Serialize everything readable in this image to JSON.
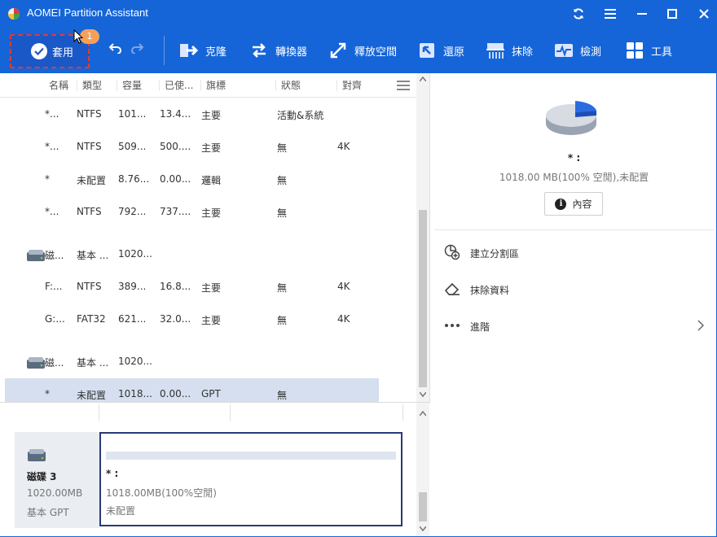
{
  "app": {
    "title": "AOMEI Partition Assistant"
  },
  "toolbar": {
    "apply_label": "套用",
    "pending_count": "1",
    "items": [
      {
        "label": "克隆",
        "icon": "clone-icon"
      },
      {
        "label": "轉換器",
        "icon": "convert-icon"
      },
      {
        "label": "釋放空間",
        "icon": "free-space-icon"
      },
      {
        "label": "還原",
        "icon": "restore-icon"
      },
      {
        "label": "抹除",
        "icon": "wipe-icon"
      },
      {
        "label": "檢測",
        "icon": "test-icon"
      },
      {
        "label": "工具",
        "icon": "tools-icon"
      }
    ]
  },
  "table": {
    "columns": [
      "名稱",
      "類型",
      "容量",
      "已使...",
      "旗標",
      "狀態",
      "對齊"
    ],
    "rows": [
      {
        "kind": "partition",
        "name": "*...",
        "type": "NTFS",
        "capacity": "101...",
        "used": "13.4...",
        "flag": "主要",
        "status": "活動&系統",
        "align": ""
      },
      {
        "kind": "partition",
        "name": "*...",
        "type": "NTFS",
        "capacity": "509...",
        "used": "500....",
        "flag": "主要",
        "status": "無",
        "align": "4K"
      },
      {
        "kind": "partition",
        "name": "*",
        "type": "未配置",
        "capacity": "8.76...",
        "used": "0.00...",
        "flag": "邏輯",
        "status": "無",
        "align": ""
      },
      {
        "kind": "partition",
        "name": "*...",
        "type": "NTFS",
        "capacity": "792...",
        "used": "737....",
        "flag": "主要",
        "status": "無",
        "align": ""
      },
      {
        "kind": "disk",
        "name": "磁...",
        "type": "基本 ...",
        "capacity": "1020...",
        "used": "",
        "flag": "",
        "status": "",
        "align": ""
      },
      {
        "kind": "partition",
        "name": "F:...",
        "type": "NTFS",
        "capacity": "389...",
        "used": "16.8...",
        "flag": "主要",
        "status": "無",
        "align": "4K"
      },
      {
        "kind": "partition",
        "name": "G:...",
        "type": "FAT32",
        "capacity": "621...",
        "used": "32.0...",
        "flag": "主要",
        "status": "無",
        "align": "4K"
      },
      {
        "kind": "disk",
        "name": "磁...",
        "type": "基本 ...",
        "capacity": "1020...",
        "used": "",
        "flag": "",
        "status": "",
        "align": ""
      },
      {
        "kind": "partition",
        "name": "*",
        "type": "未配置",
        "capacity": "1018...",
        "used": "0.00...",
        "flag": "GPT",
        "status": "無",
        "align": "",
        "selected": true
      }
    ]
  },
  "disk_map": {
    "disk_name": "磁碟 3",
    "disk_size": "1020.00MB",
    "disk_type": "基本 GPT",
    "partition_label": "* :",
    "partition_size": "1018.00MB(100%空閒)",
    "partition_type": "未配置"
  },
  "details": {
    "label": "* :",
    "info": "1018.00 MB(100% 空閒),未配置",
    "properties_label": "內容",
    "unallocated_fraction": 1.0
  },
  "operations": [
    {
      "label": "建立分割區",
      "icon": "create-partition-icon"
    },
    {
      "label": "抹除資料",
      "icon": "eraser-icon"
    },
    {
      "label": "進階",
      "icon": "more-icon"
    }
  ],
  "colors": {
    "accent": "#1565d8",
    "selected_row": "#d5dfef",
    "pie_blue": "#2b6be0"
  }
}
